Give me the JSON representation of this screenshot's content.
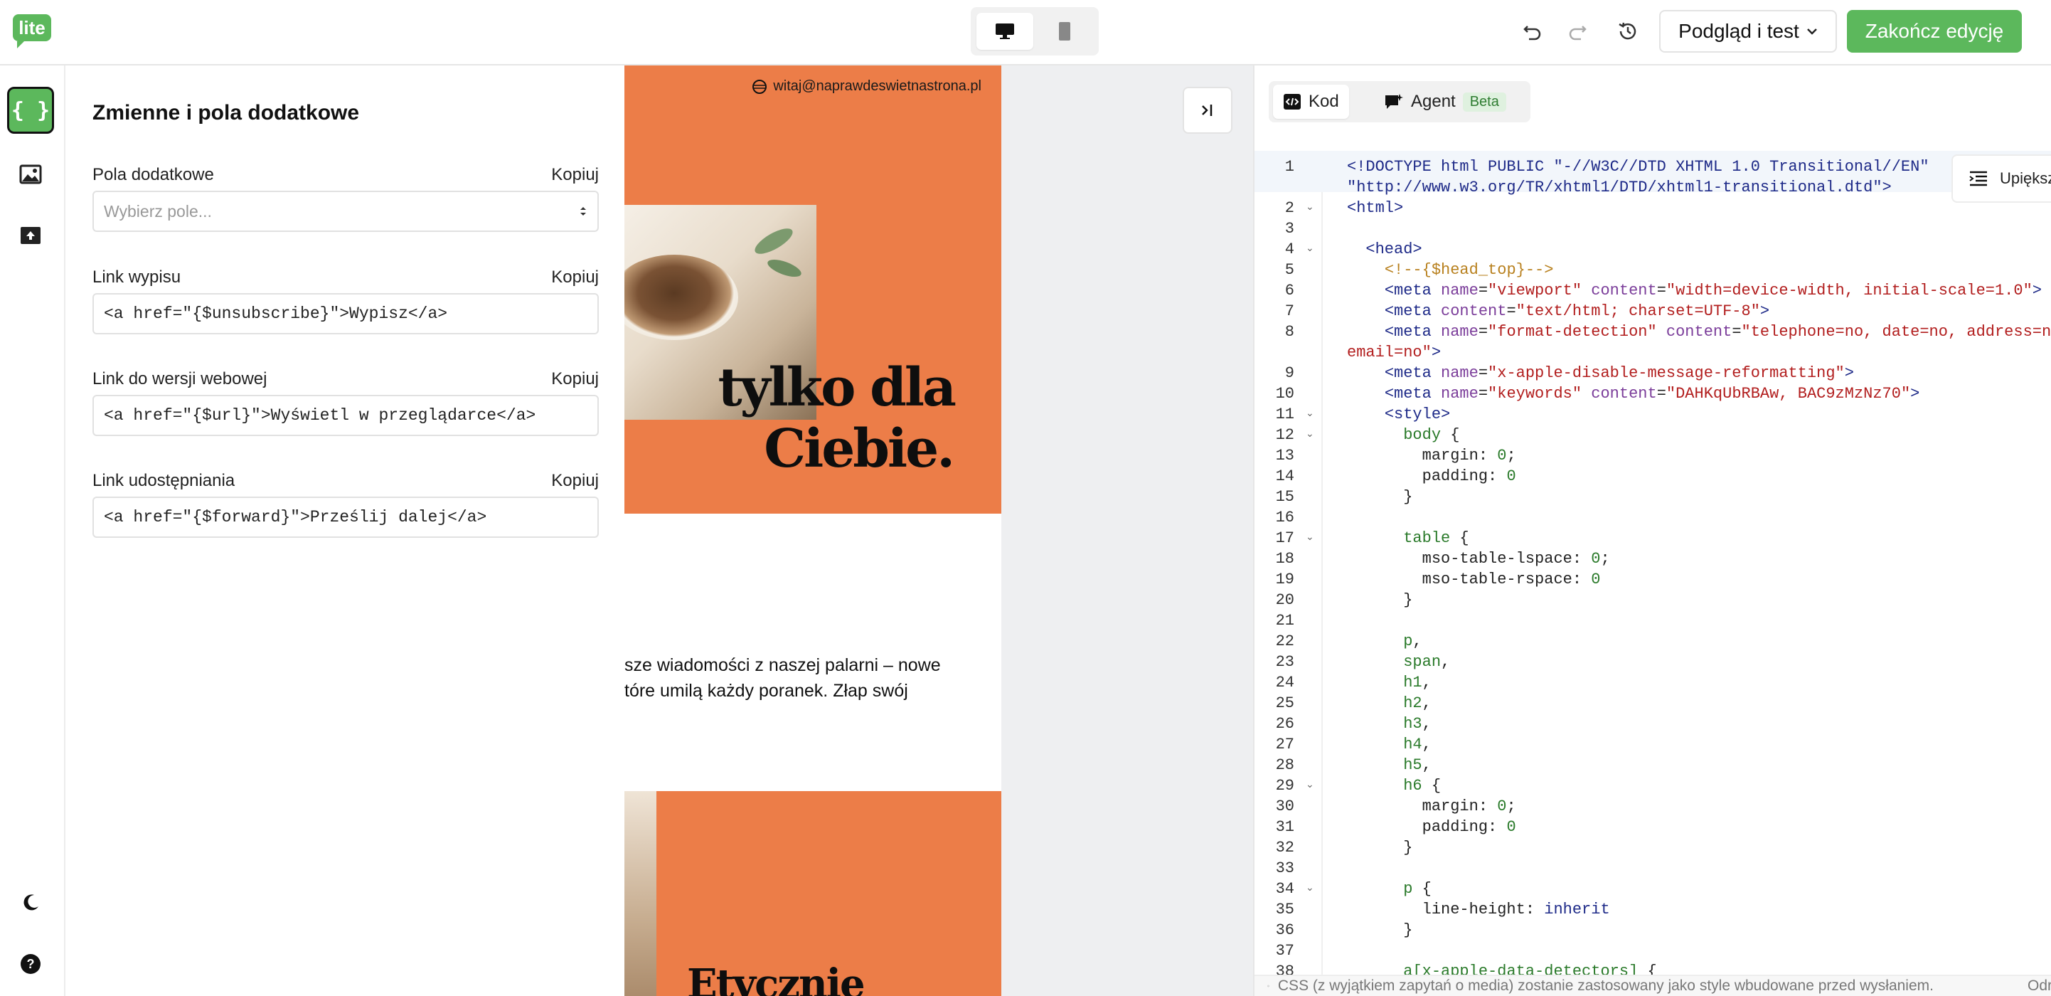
{
  "header": {
    "logo": "lite",
    "preview_label": "Podgląd i test",
    "finish_label": "Zakończ edycję"
  },
  "panel": {
    "title": "Zmienne i pola dodatkowe",
    "fields": [
      {
        "label": "Pola dodatkowe",
        "copy": "Kopiuj",
        "placeholder": "Wybierz pole...",
        "value": ""
      },
      {
        "label": "Link wypisu",
        "copy": "Kopiuj",
        "value": "<a href=\"{$unsubscribe}\">Wypisz</a>"
      },
      {
        "label": "Link do wersji webowej",
        "copy": "Kopiuj",
        "value": "<a href=\"{$url}\">Wyświetl w przeglądarce</a>"
      },
      {
        "label": "Link udostępniania",
        "copy": "Kopiuj",
        "value": "<a href=\"{$forward}\">Prześlij dalej</a>"
      }
    ]
  },
  "email": {
    "address": "witaj@naprawdeswietnastrona.pl",
    "hero_line1": "tylko dla",
    "hero_line2": "Ciebie.",
    "body_line1": "sze wiadomości z naszej palarni – nowe",
    "body_line2": "tóre umilą każdy poranek. Złap swój",
    "hero2_text": "Etycznie"
  },
  "code_panel": {
    "tab_code": "Kod",
    "tab_agent": "Agent",
    "beta": "Beta",
    "beautify": "Upiększ",
    "footer_note": "CSS (z wyjątkiem zapytań o media) zostanie zastosowany jako style wbudowane przed wysłaniem.",
    "footer_right": "Odr",
    "lines": [
      {
        "n": "1",
        "html": "<span class='t'>&lt;!DOCTYPE html PUBLIC \"-//W3C//DTD XHTML 1.0 Transitional//EN\"</span>"
      },
      {
        "n": "",
        "html": "<span class='t'>\"http://www.w3.org/TR/xhtml1/DTD/xhtml1-transitional.dtd\"&gt;</span>"
      },
      {
        "n": "2",
        "fold": true,
        "html": "<span class='t'>&lt;html&gt;</span>"
      },
      {
        "n": "3",
        "html": ""
      },
      {
        "n": "4",
        "fold": true,
        "html": "  <span class='t'>&lt;head&gt;</span>"
      },
      {
        "n": "5",
        "html": "    <span class='c'>&lt;!--{$head_top}--&gt;</span>"
      },
      {
        "n": "6",
        "html": "    <span class='t'>&lt;meta</span> <span class='a'>name</span>=<span class='s'>\"viewport\"</span> <span class='a'>content</span>=<span class='s'>\"width=device-width, initial-scale=1.0\"</span><span class='t'>&gt;</span>"
      },
      {
        "n": "7",
        "html": "    <span class='t'>&lt;meta</span> <span class='a'>content</span>=<span class='s'>\"text/html; charset=UTF-8\"</span><span class='t'>&gt;</span>"
      },
      {
        "n": "8",
        "html": "    <span class='t'>&lt;meta</span> <span class='a'>name</span>=<span class='s'>\"format-detection\"</span> <span class='a'>content</span>=<span class='s'>\"telephone=no, date=no, address=no,</span>"
      },
      {
        "n": "",
        "html": "<span class='s'>email=no\"</span><span class='t'>&gt;</span>"
      },
      {
        "n": "9",
        "html": "    <span class='t'>&lt;meta</span> <span class='a'>name</span>=<span class='s'>\"x-apple-disable-message-reformatting\"</span><span class='t'>&gt;</span>"
      },
      {
        "n": "10",
        "html": "    <span class='t'>&lt;meta</span> <span class='a'>name</span>=<span class='s'>\"keywords\"</span> <span class='a'>content</span>=<span class='s'>\"DAHKqUbRBAw, BAC9zMzNz70\"</span><span class='t'>&gt;</span>"
      },
      {
        "n": "11",
        "fold": true,
        "html": "    <span class='t'>&lt;style&gt;</span>"
      },
      {
        "n": "12",
        "fold": true,
        "html": "      <span class='k'>body</span> {"
      },
      {
        "n": "13",
        "html": "        margin: <span class='k'>0</span>;"
      },
      {
        "n": "14",
        "html": "        padding: <span class='k'>0</span>"
      },
      {
        "n": "15",
        "html": "      }"
      },
      {
        "n": "16",
        "html": ""
      },
      {
        "n": "17",
        "fold": true,
        "html": "      <span class='k'>table</span> {"
      },
      {
        "n": "18",
        "html": "        mso-table-lspace: <span class='k'>0</span>;"
      },
      {
        "n": "19",
        "html": "        mso-table-rspace: <span class='k'>0</span>"
      },
      {
        "n": "20",
        "html": "      }"
      },
      {
        "n": "21",
        "html": ""
      },
      {
        "n": "22",
        "html": "      <span class='k'>p</span>,"
      },
      {
        "n": "23",
        "html": "      <span class='k'>span</span>,"
      },
      {
        "n": "24",
        "html": "      <span class='k'>h1</span>,"
      },
      {
        "n": "25",
        "html": "      <span class='k'>h2</span>,"
      },
      {
        "n": "26",
        "html": "      <span class='k'>h3</span>,"
      },
      {
        "n": "27",
        "html": "      <span class='k'>h4</span>,"
      },
      {
        "n": "28",
        "html": "      <span class='k'>h5</span>,"
      },
      {
        "n": "29",
        "fold": true,
        "html": "      <span class='k'>h6</span> {"
      },
      {
        "n": "30",
        "html": "        margin: <span class='k'>0</span>;"
      },
      {
        "n": "31",
        "html": "        padding: <span class='k'>0</span>"
      },
      {
        "n": "32",
        "html": "      }"
      },
      {
        "n": "33",
        "html": ""
      },
      {
        "n": "34",
        "fold": true,
        "html": "      <span class='k'>p</span> {"
      },
      {
        "n": "35",
        "html": "        line-height: <span class='v'>inherit</span>"
      },
      {
        "n": "36",
        "html": "      }"
      },
      {
        "n": "37",
        "html": ""
      },
      {
        "n": "38",
        "html": "      <span class='k'>a[x-apple-data-detectors]</span> {"
      }
    ]
  },
  "colors": {
    "accent": "#5cb85c",
    "hero": "#ec7d48"
  }
}
